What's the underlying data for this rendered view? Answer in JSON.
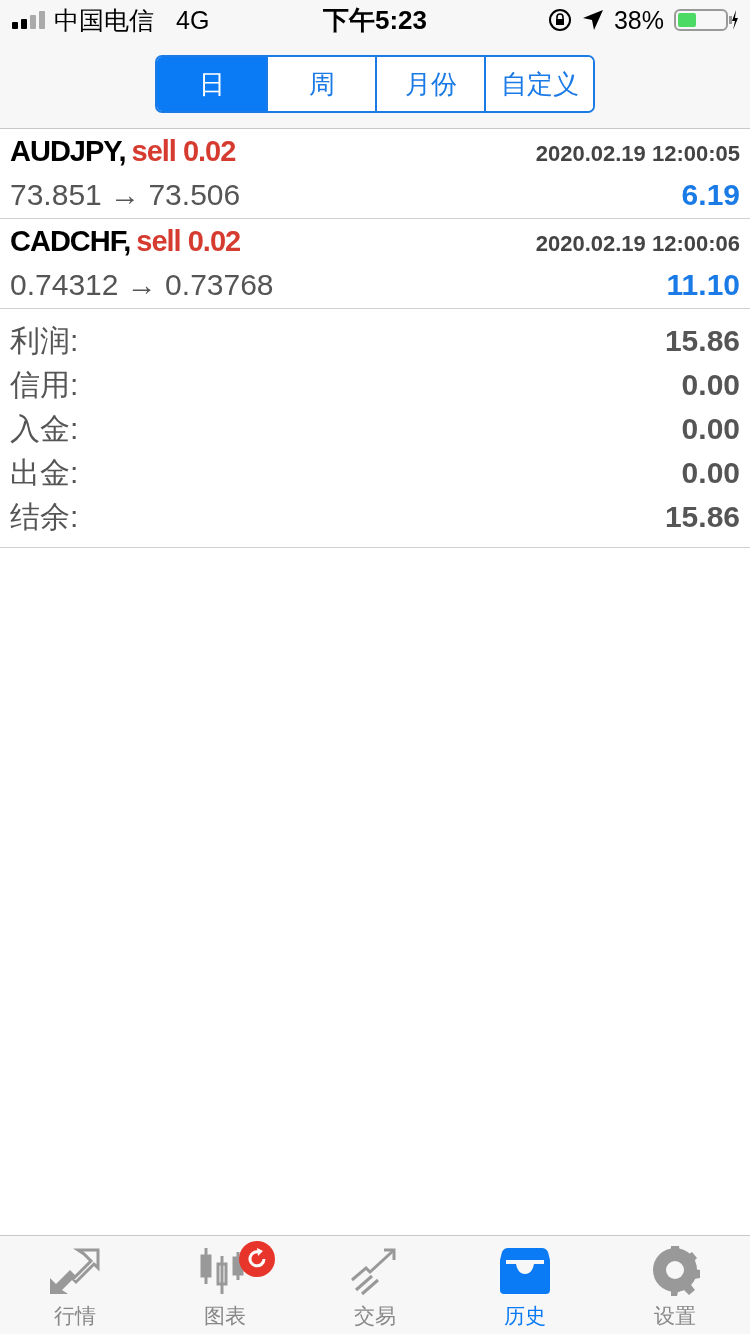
{
  "status_bar": {
    "carrier": "中国电信",
    "network": "4G",
    "time": "下午5:23",
    "battery": "38%"
  },
  "segments": [
    {
      "label": "日",
      "selected": true
    },
    {
      "label": "周",
      "selected": false
    },
    {
      "label": "月份",
      "selected": false
    },
    {
      "label": "自定义",
      "selected": false
    }
  ],
  "deals": [
    {
      "symbol": "AUDJPY,",
      "order": "sell 0.02",
      "time": "2020.02.19 12:00:05",
      "prices": "73.851 → 73.506",
      "profit": "6.19"
    },
    {
      "symbol": "CADCHF,",
      "order": "sell 0.02",
      "time": "2020.02.19 12:00:06",
      "prices": "0.74312 → 0.73768",
      "profit": "11.10"
    }
  ],
  "summary": [
    {
      "label": "利润:",
      "value": "15.86"
    },
    {
      "label": "信用:",
      "value": "0.00"
    },
    {
      "label": "入金:",
      "value": "0.00"
    },
    {
      "label": "出金:",
      "value": "0.00"
    },
    {
      "label": "结余:",
      "value": "15.86"
    }
  ],
  "tab_bar": [
    {
      "kind": "quotes",
      "label": "行情",
      "selected": false,
      "badge": false
    },
    {
      "kind": "chart",
      "label": "图表",
      "selected": false,
      "badge": true
    },
    {
      "kind": "trade",
      "label": "交易",
      "selected": false,
      "badge": false
    },
    {
      "kind": "history",
      "label": "历史",
      "selected": true,
      "badge": false
    },
    {
      "kind": "settings",
      "label": "设置",
      "selected": false,
      "badge": false
    }
  ]
}
